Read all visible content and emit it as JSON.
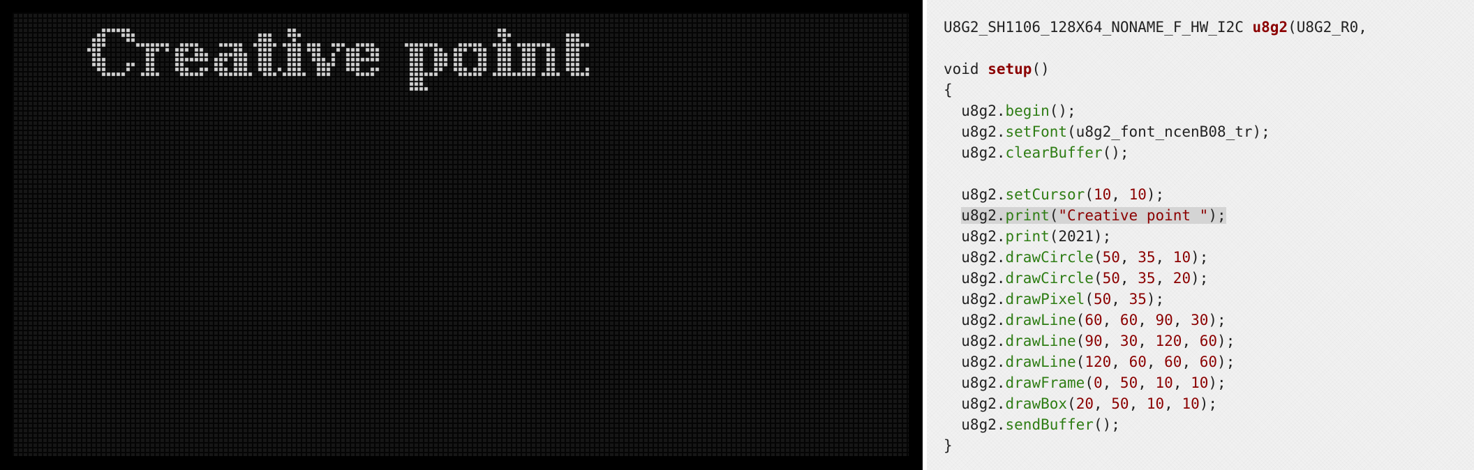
{
  "oled": {
    "display_text": "Creative point",
    "pixel_color": "#d2d2d2",
    "off_pixel_color": "#161616",
    "grid_color": "#050505"
  },
  "code": {
    "highlighted_line": 9,
    "lines": [
      [
        {
          "t": "type",
          "v": "U8G2_SH1106_128X64_NONAME_F_HW_I2C "
        },
        {
          "t": "defname",
          "v": "u8g2"
        },
        {
          "t": "punct",
          "v": "(U8G2_R0,"
        }
      ],
      [],
      [
        {
          "t": "keyword",
          "v": "void "
        },
        {
          "t": "defname",
          "v": "setup"
        },
        {
          "t": "punct",
          "v": "()"
        }
      ],
      [
        {
          "t": "punct",
          "v": "{"
        }
      ],
      [
        {
          "t": "obj",
          "v": "  u8g2."
        },
        {
          "t": "method",
          "v": "begin"
        },
        {
          "t": "punct",
          "v": "();"
        }
      ],
      [
        {
          "t": "obj",
          "v": "  u8g2."
        },
        {
          "t": "method",
          "v": "setFont"
        },
        {
          "t": "punct",
          "v": "(u8g2_font_ncenB08_tr);"
        }
      ],
      [
        {
          "t": "obj",
          "v": "  u8g2."
        },
        {
          "t": "method",
          "v": "clearBuffer"
        },
        {
          "t": "punct",
          "v": "();"
        }
      ],
      [],
      [
        {
          "t": "obj",
          "v": "  u8g2."
        },
        {
          "t": "method",
          "v": "setCursor"
        },
        {
          "t": "punct",
          "v": "("
        },
        {
          "t": "num",
          "v": "10"
        },
        {
          "t": "punct",
          "v": ", "
        },
        {
          "t": "num",
          "v": "10"
        },
        {
          "t": "punct",
          "v": ");"
        }
      ],
      [
        {
          "t": "obj",
          "v": "  u8g2."
        },
        {
          "t": "method",
          "v": "print"
        },
        {
          "t": "punct",
          "v": "("
        },
        {
          "t": "str",
          "v": "\"Creative point \""
        },
        {
          "t": "punct",
          "v": ");"
        }
      ],
      [
        {
          "t": "obj",
          "v": "  u8g2."
        },
        {
          "t": "method",
          "v": "print"
        },
        {
          "t": "punct",
          "v": "(2021);"
        }
      ],
      [
        {
          "t": "obj",
          "v": "  u8g2."
        },
        {
          "t": "method",
          "v": "drawCircle"
        },
        {
          "t": "punct",
          "v": "("
        },
        {
          "t": "num",
          "v": "50"
        },
        {
          "t": "punct",
          "v": ", "
        },
        {
          "t": "num",
          "v": "35"
        },
        {
          "t": "punct",
          "v": ", "
        },
        {
          "t": "num",
          "v": "10"
        },
        {
          "t": "punct",
          "v": ");"
        }
      ],
      [
        {
          "t": "obj",
          "v": "  u8g2."
        },
        {
          "t": "method",
          "v": "drawCircle"
        },
        {
          "t": "punct",
          "v": "("
        },
        {
          "t": "num",
          "v": "50"
        },
        {
          "t": "punct",
          "v": ", "
        },
        {
          "t": "num",
          "v": "35"
        },
        {
          "t": "punct",
          "v": ", "
        },
        {
          "t": "num",
          "v": "20"
        },
        {
          "t": "punct",
          "v": ");"
        }
      ],
      [
        {
          "t": "obj",
          "v": "  u8g2."
        },
        {
          "t": "method",
          "v": "drawPixel"
        },
        {
          "t": "punct",
          "v": "("
        },
        {
          "t": "num",
          "v": "50"
        },
        {
          "t": "punct",
          "v": ", "
        },
        {
          "t": "num",
          "v": "35"
        },
        {
          "t": "punct",
          "v": ");"
        }
      ],
      [
        {
          "t": "obj",
          "v": "  u8g2."
        },
        {
          "t": "method",
          "v": "drawLine"
        },
        {
          "t": "punct",
          "v": "("
        },
        {
          "t": "num",
          "v": "60"
        },
        {
          "t": "punct",
          "v": ", "
        },
        {
          "t": "num",
          "v": "60"
        },
        {
          "t": "punct",
          "v": ", "
        },
        {
          "t": "num",
          "v": "90"
        },
        {
          "t": "punct",
          "v": ", "
        },
        {
          "t": "num",
          "v": "30"
        },
        {
          "t": "punct",
          "v": ");"
        }
      ],
      [
        {
          "t": "obj",
          "v": "  u8g2."
        },
        {
          "t": "method",
          "v": "drawLine"
        },
        {
          "t": "punct",
          "v": "("
        },
        {
          "t": "num",
          "v": "90"
        },
        {
          "t": "punct",
          "v": ", "
        },
        {
          "t": "num",
          "v": "30"
        },
        {
          "t": "punct",
          "v": ", "
        },
        {
          "t": "num",
          "v": "120"
        },
        {
          "t": "punct",
          "v": ", "
        },
        {
          "t": "num",
          "v": "60"
        },
        {
          "t": "punct",
          "v": ");"
        }
      ],
      [
        {
          "t": "obj",
          "v": "  u8g2."
        },
        {
          "t": "method",
          "v": "drawLine"
        },
        {
          "t": "punct",
          "v": "("
        },
        {
          "t": "num",
          "v": "120"
        },
        {
          "t": "punct",
          "v": ", "
        },
        {
          "t": "num",
          "v": "60"
        },
        {
          "t": "punct",
          "v": ", "
        },
        {
          "t": "num",
          "v": "60"
        },
        {
          "t": "punct",
          "v": ", "
        },
        {
          "t": "num",
          "v": "60"
        },
        {
          "t": "punct",
          "v": ");"
        }
      ],
      [
        {
          "t": "obj",
          "v": "  u8g2."
        },
        {
          "t": "method",
          "v": "drawFrame"
        },
        {
          "t": "punct",
          "v": "("
        },
        {
          "t": "num",
          "v": "0"
        },
        {
          "t": "punct",
          "v": ", "
        },
        {
          "t": "num",
          "v": "50"
        },
        {
          "t": "punct",
          "v": ", "
        },
        {
          "t": "num",
          "v": "10"
        },
        {
          "t": "punct",
          "v": ", "
        },
        {
          "t": "num",
          "v": "10"
        },
        {
          "t": "punct",
          "v": ");"
        }
      ],
      [
        {
          "t": "obj",
          "v": "  u8g2."
        },
        {
          "t": "method",
          "v": "drawBox"
        },
        {
          "t": "punct",
          "v": "("
        },
        {
          "t": "num",
          "v": "20"
        },
        {
          "t": "punct",
          "v": ", "
        },
        {
          "t": "num",
          "v": "50"
        },
        {
          "t": "punct",
          "v": ", "
        },
        {
          "t": "num",
          "v": "10"
        },
        {
          "t": "punct",
          "v": ", "
        },
        {
          "t": "num",
          "v": "10"
        },
        {
          "t": "punct",
          "v": ");"
        }
      ],
      [
        {
          "t": "obj",
          "v": "  u8g2."
        },
        {
          "t": "method",
          "v": "sendBuffer"
        },
        {
          "t": "punct",
          "v": "();"
        }
      ],
      [
        {
          "t": "punct",
          "v": "}"
        }
      ]
    ]
  }
}
